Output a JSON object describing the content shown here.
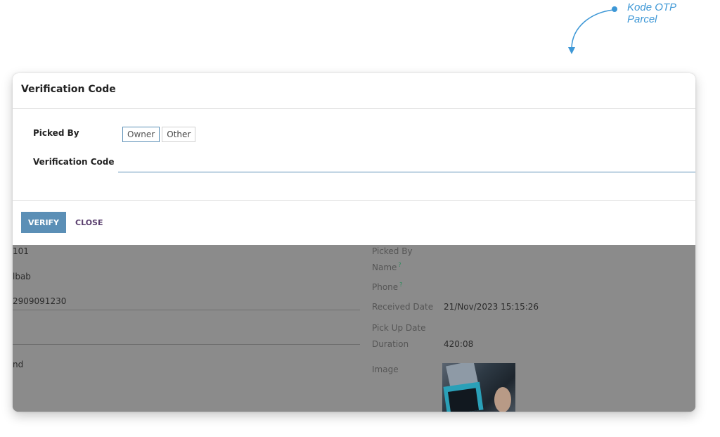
{
  "annotation": {
    "line1": "Kode OTP",
    "line2": "Parcel",
    "color": "#3d97d6"
  },
  "modal": {
    "title": "Verification Code",
    "picked_by_label": "Picked By",
    "picked_by_options": [
      {
        "label": "Owner",
        "selected": true
      },
      {
        "label": "Other",
        "selected": false
      }
    ],
    "verification_code_label": "Verification Code",
    "verification_code_value": "",
    "verify_label": "VERIFY",
    "close_label": "CLOSE",
    "accent": "#5b8fb6"
  },
  "background_form": {
    "left_values": [
      "101",
      "lbab",
      "2909091230",
      "nd"
    ],
    "right": {
      "picked_by_label": "Picked By",
      "name_label": "Name",
      "phone_label": "Phone",
      "received_date_label": "Received Date",
      "received_date_value": "21/Nov/2023 15:15:26",
      "pickup_date_label": "Pick Up Date",
      "duration_label": "Duration",
      "duration_value": "420:08",
      "image_label": "Image",
      "help_mark": "?"
    }
  }
}
